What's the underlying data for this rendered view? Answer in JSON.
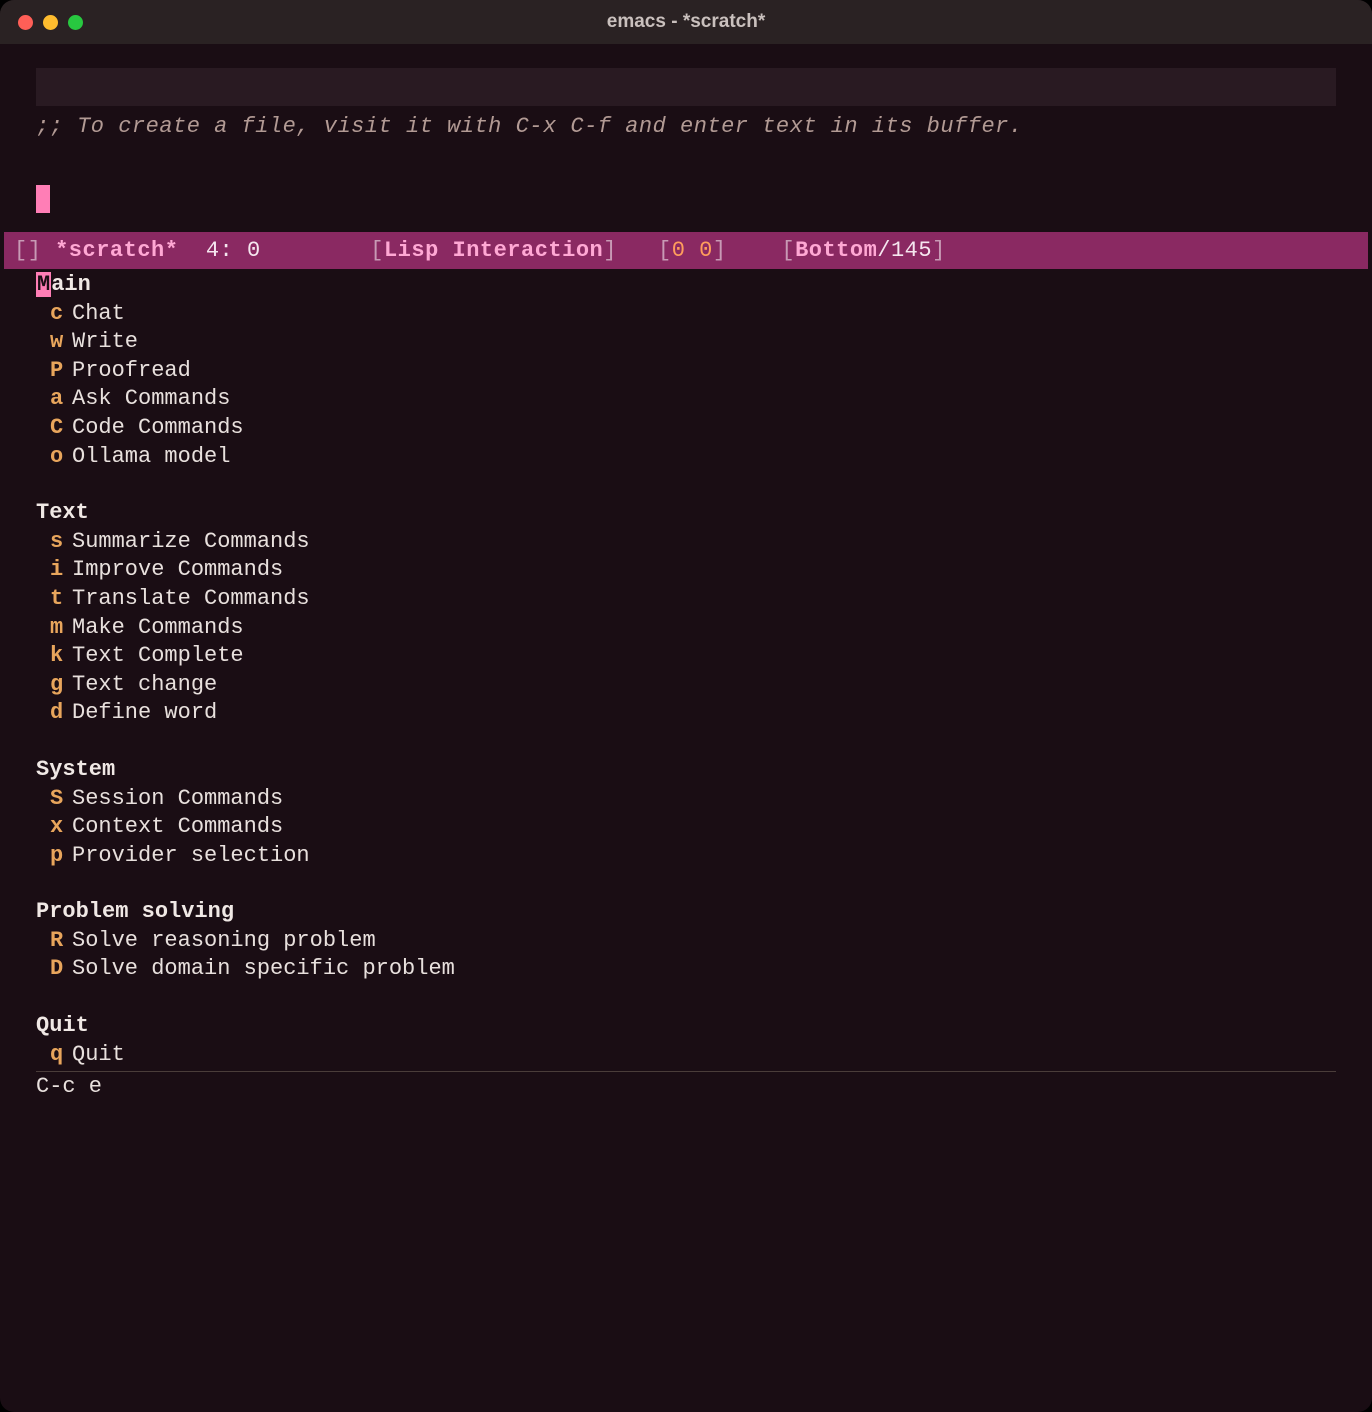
{
  "window": {
    "title": "emacs - *scratch*"
  },
  "buffer": {
    "comment": ";; To create a file, visit it with C-x C-f and enter text in its buffer."
  },
  "modeline": {
    "brackets": "[]",
    "buffer_name": "*scratch*",
    "line_col": "4: 0",
    "mode_open": "[",
    "mode": "Lisp Interaction",
    "mode_close": "]",
    "pos_open": "[",
    "pos": "0 0",
    "pos_close": "]",
    "scroll_open": "[",
    "scroll_word": "Bottom",
    "scroll_sep": "/",
    "scroll_total": "145",
    "scroll_close": "]"
  },
  "menu": {
    "sections": [
      {
        "title": "Main",
        "title_hkey": "M",
        "title_rest": "ain",
        "items": [
          {
            "key": "c",
            "label": "Chat"
          },
          {
            "key": "w",
            "label": "Write"
          },
          {
            "key": "P",
            "label": "Proofread"
          },
          {
            "key": "a",
            "label": "Ask Commands"
          },
          {
            "key": "C",
            "label": "Code Commands"
          },
          {
            "key": "o",
            "label": "Ollama model"
          }
        ]
      },
      {
        "title": "Text",
        "items": [
          {
            "key": "s",
            "label": "Summarize Commands"
          },
          {
            "key": "i",
            "label": "Improve Commands"
          },
          {
            "key": "t",
            "label": "Translate Commands"
          },
          {
            "key": "m",
            "label": "Make Commands"
          },
          {
            "key": "k",
            "label": "Text Complete"
          },
          {
            "key": "g",
            "label": "Text change"
          },
          {
            "key": "d",
            "label": "Define word"
          }
        ]
      },
      {
        "title": "System",
        "items": [
          {
            "key": "S",
            "label": "Session Commands"
          },
          {
            "key": "x",
            "label": "Context Commands"
          },
          {
            "key": "p",
            "label": "Provider selection"
          }
        ]
      },
      {
        "title": "Problem solving",
        "items": [
          {
            "key": "R",
            "label": "Solve reasoning problem"
          },
          {
            "key": "D",
            "label": "Solve domain specific problem"
          }
        ]
      },
      {
        "title": "Quit",
        "items": [
          {
            "key": "q",
            "label": "Quit"
          }
        ]
      }
    ]
  },
  "minibuffer": {
    "text": "C-c e"
  },
  "colors": {
    "bg": "#1a0d14",
    "modeline_bg": "#8a2962",
    "accent": "#ff7eb6",
    "key": "#e8a55c",
    "text": "#e8e0dd"
  }
}
